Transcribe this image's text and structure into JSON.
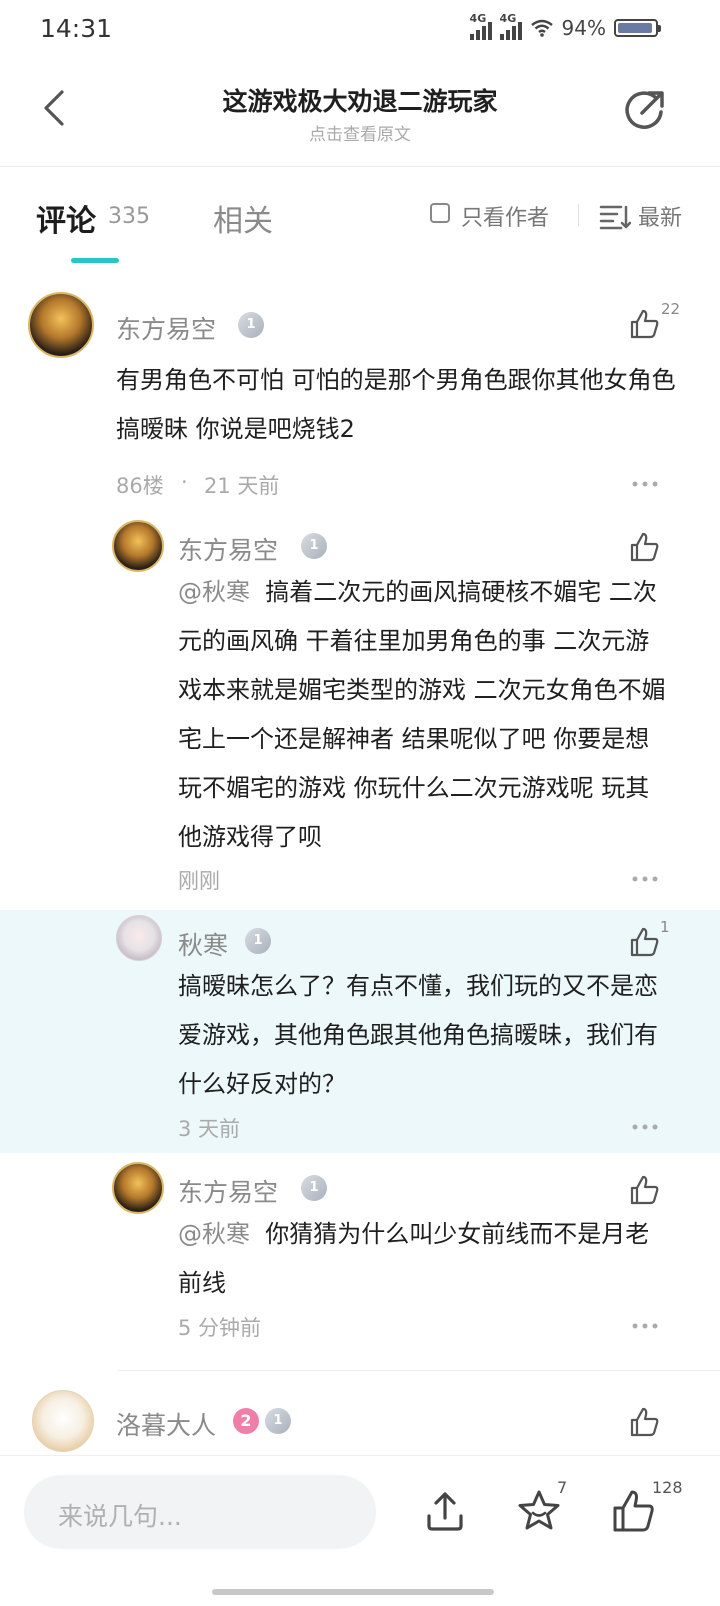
{
  "status_bar": {
    "time": "14:31",
    "network1": "4G",
    "network2": "4G",
    "battery": "94%",
    "battery_level": 0.94
  },
  "header": {
    "title": "这游戏极大劝退二游玩家",
    "subtitle": "点击查看原文"
  },
  "tabs": {
    "comments_label": "评论",
    "comments_count": "335",
    "related_label": "相关",
    "author_only": "只看作者",
    "sort_label": "最新"
  },
  "comments": [
    {
      "user": "东方易空",
      "level": "1",
      "likes": "22",
      "text": "有男角色不可怕 可怕的是那个男角色跟你其他女角色搞暧昧 你说是吧烧钱2",
      "floor": "86楼",
      "time": "21 天前"
    }
  ],
  "replies": [
    {
      "user": "东方易空",
      "level": "1",
      "likes": "",
      "mention": "@秋寒",
      "text": "搞着二次元的画风搞硬核不媚宅 二次元的画风确 干着往里加男角色的事 二次元游戏本来就是媚宅类型的游戏  二次元女角色不媚宅上一个还是解神者  结果呢似了吧 你要是想玩不媚宅的游戏 你玩什么二次元游戏呢 玩其他游戏得了呗",
      "time": "刚刚"
    },
    {
      "user": "秋寒",
      "level": "1",
      "likes": "1",
      "mention": "",
      "text": "搞暧昧怎么了？有点不懂，我们玩的又不是恋爱游戏，其他角色跟其他角色搞暧昧，我们有什么好反对的？",
      "time": "3 天前"
    },
    {
      "user": "东方易空",
      "level": "1",
      "likes": "",
      "mention": "@秋寒",
      "text": "你猜猜为什么叫少女前线而不是月老前线",
      "time": "5 分钟前"
    }
  ],
  "next_comment": {
    "user": "洛暮大人",
    "badge": "2",
    "level": "1"
  },
  "bottom_bar": {
    "placeholder": "来说几句...",
    "favorites": "7",
    "likes": "128"
  },
  "colors": {
    "accent": "#26c6c3",
    "highlight": "#edf8fa",
    "badge_pink": "#ef7fa8"
  }
}
